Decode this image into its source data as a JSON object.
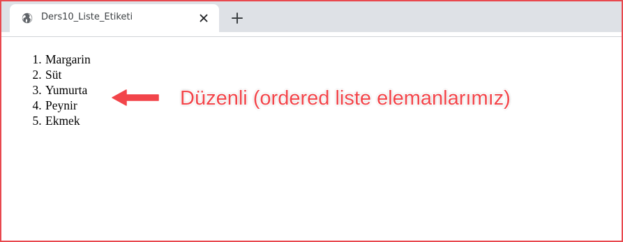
{
  "browser": {
    "tab": {
      "title": "Ders10_Liste_Etiketi",
      "favicon": "globe-icon",
      "close_icon": "close-icon"
    },
    "new_tab_icon": "plus-icon"
  },
  "page": {
    "ordered_list": [
      "Margarin",
      "Süt",
      "Yumurta",
      "Peynir",
      "Ekmek"
    ]
  },
  "annotation": {
    "text": "Düzenli (ordered liste elemanlarımız)",
    "arrow_icon": "arrow-left-icon",
    "color": "#f2454a"
  },
  "colors": {
    "frame_border": "#e8484e",
    "tabstrip": "#dee1e6",
    "tab_active": "#ffffff"
  }
}
